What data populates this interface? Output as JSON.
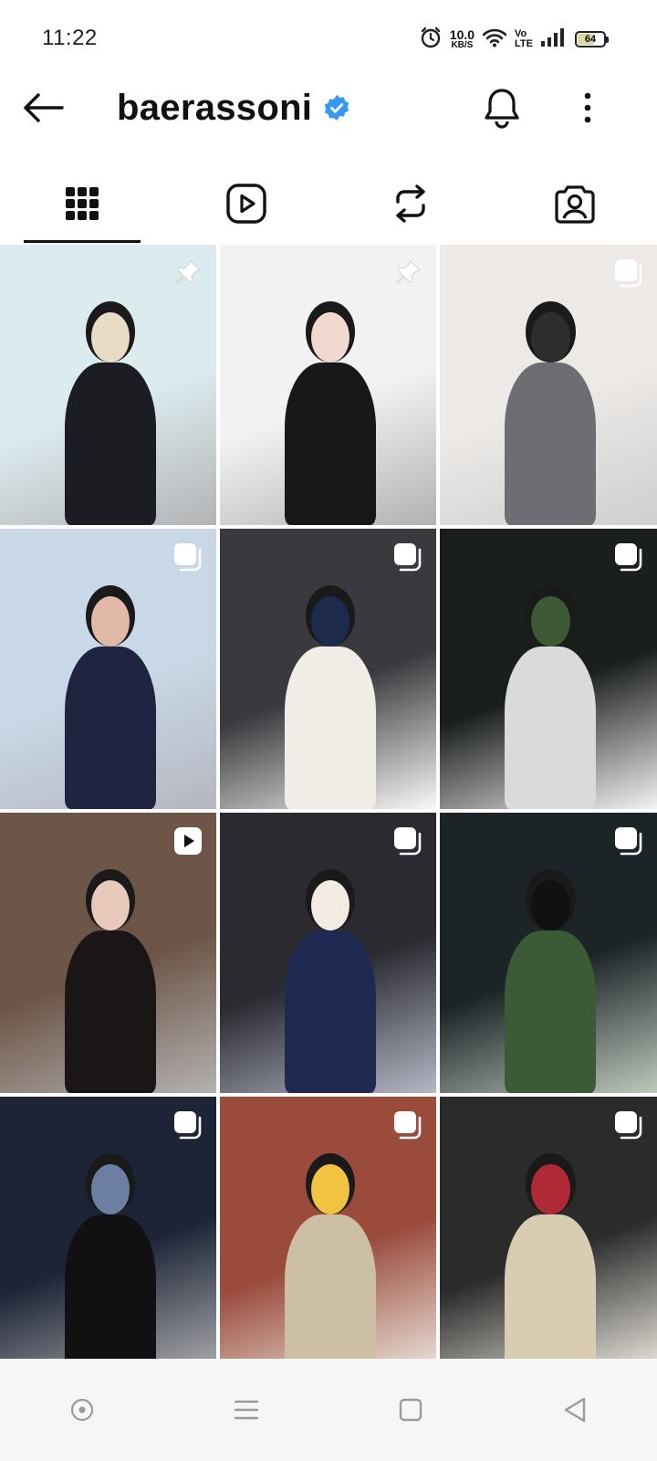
{
  "status_bar": {
    "time": "11:22",
    "net_speed_value": "10.0",
    "net_speed_unit": "KB/S",
    "volte_top": "Vo",
    "volte_bottom": "LTE",
    "battery": "64",
    "battery_level_fraction": 0.64,
    "icons": [
      "alarm-icon",
      "wifi-icon",
      "signal-icon",
      "battery-icon"
    ]
  },
  "header": {
    "username": "baerassoni",
    "verified": true,
    "accent_color": "#3897f0",
    "icons": [
      "back-arrow-icon",
      "verified-badge-icon",
      "bell-icon",
      "more-vert-icon"
    ]
  },
  "tabs": [
    {
      "name": "posts",
      "icon": "grid-icon",
      "active": true
    },
    {
      "name": "reels",
      "icon": "reels-icon",
      "active": false
    },
    {
      "name": "reposts",
      "icon": "repost-icon",
      "active": false
    },
    {
      "name": "tagged",
      "icon": "tagged-icon",
      "active": false
    }
  ],
  "grid": {
    "posts": [
      {
        "badge": "pin-icon",
        "palette": [
          "#dcebee",
          "#1b1d22",
          "#e8dcc4"
        ]
      },
      {
        "badge": "pin-icon",
        "palette": [
          "#f2f2f4",
          "#17181a",
          "#f1d9cf"
        ]
      },
      {
        "badge": "carousel-icon",
        "palette": [
          "#ece9e6",
          "#6c6e73",
          "#2d2d2f"
        ]
      },
      {
        "badge": "carousel-icon",
        "palette": [
          "#c9d8e6",
          "#1f2540",
          "#e2b8a8"
        ]
      },
      {
        "badge": "carousel-icon",
        "palette": [
          "#3a3a3e",
          "#f0ece6",
          "#1e2a4c"
        ]
      },
      {
        "badge": "carousel-icon",
        "palette": [
          "#1b1f1c",
          "#dadada",
          "#3e5a34"
        ]
      },
      {
        "badge": "reel-icon",
        "palette": [
          "#6d5647",
          "#1b1616",
          "#e9c9bb"
        ]
      },
      {
        "badge": "carousel-icon",
        "palette": [
          "#2a2a30",
          "#1f2a52",
          "#f2ebe3"
        ]
      },
      {
        "badge": "carousel-icon",
        "palette": [
          "#1c2428",
          "#3b5b36",
          "#111111"
        ]
      },
      {
        "badge": "carousel-icon",
        "palette": [
          "#1d2436",
          "#111114",
          "#6c7fa3"
        ]
      },
      {
        "badge": "carousel-icon",
        "palette": [
          "#9a4b3c",
          "#cdbfa5",
          "#f1c341"
        ]
      },
      {
        "badge": "carousel-icon",
        "palette": [
          "#2b2b2b",
          "#d8ccb3",
          "#b02a35"
        ]
      }
    ]
  },
  "nav_bar": {
    "buttons": [
      "assistant-dot-icon",
      "menu-icon",
      "home-square-icon",
      "back-triangle-icon"
    ]
  }
}
